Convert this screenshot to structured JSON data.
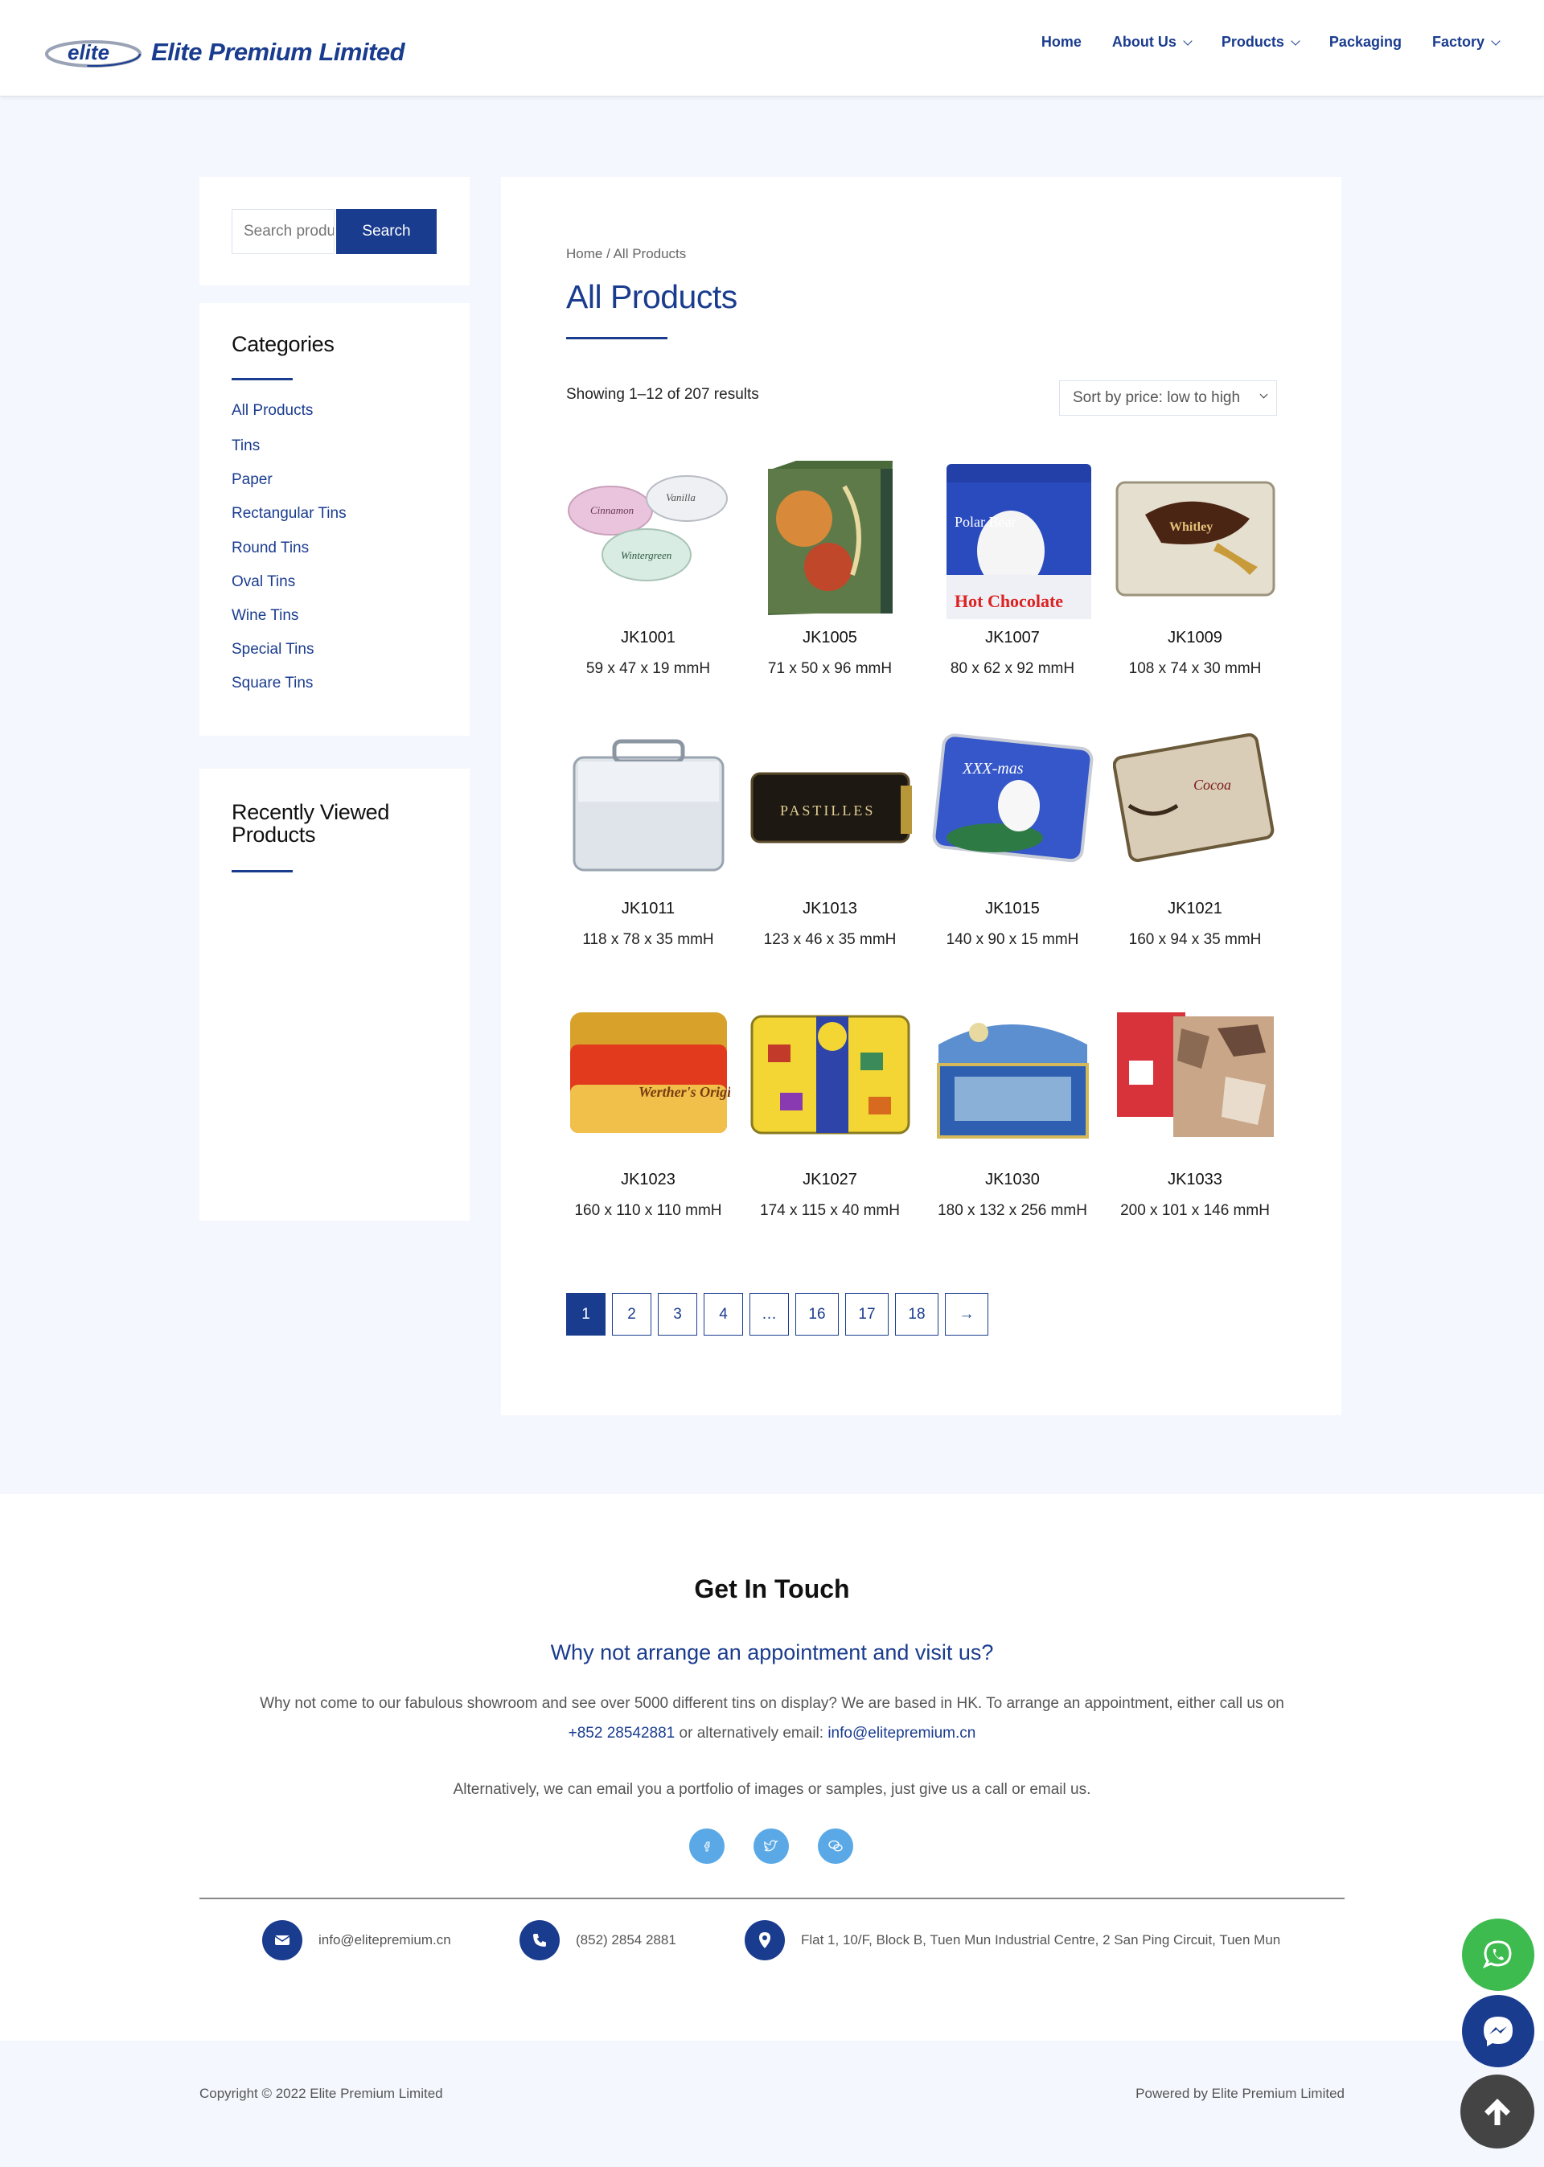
{
  "brand": {
    "logo_mark": "elite",
    "name": "Elite Premium Limited",
    "color": "#1a3c8f"
  },
  "nav": {
    "items": [
      {
        "label": "Home",
        "has_dropdown": false
      },
      {
        "label": "About Us",
        "has_dropdown": true
      },
      {
        "label": "Products",
        "has_dropdown": true
      },
      {
        "label": "Packaging",
        "has_dropdown": false
      },
      {
        "label": "Factory",
        "has_dropdown": true
      }
    ]
  },
  "sidebar": {
    "search": {
      "placeholder": "Search products…",
      "button_label": "Search"
    },
    "categories_title": "Categories",
    "categories": [
      "All Products",
      "Tins",
      "Paper",
      "Rectangular Tins",
      "Round Tins",
      "Oval Tins",
      "Wine Tins",
      "Special Tins",
      "Square Tins"
    ],
    "recent_title": "Recently Viewed Products"
  },
  "main": {
    "breadcrumb": "Home / All Products",
    "title": "All Products",
    "result_count": "Showing 1–12 of 207 results",
    "sort_selected": "Sort by price: low to high",
    "products": [
      {
        "sku": "JK1001",
        "dims": "59 x 47 x 19 mmH"
      },
      {
        "sku": "JK1005",
        "dims": "71 x 50 x 96 mmH"
      },
      {
        "sku": "JK1007",
        "dims": "80 x 62 x 92 mmH"
      },
      {
        "sku": "JK1009",
        "dims": "108 x 74 x 30 mmH"
      },
      {
        "sku": "JK1011",
        "dims": "118 x 78 x 35 mmH"
      },
      {
        "sku": "JK1013",
        "dims": "123 x 46 x 35 mmH"
      },
      {
        "sku": "JK1015",
        "dims": "140 x 90 x 15 mmH"
      },
      {
        "sku": "JK1021",
        "dims": "160 x 94 x 35 mmH"
      },
      {
        "sku": "JK1023",
        "dims": "160 x 110 x 110 mmH"
      },
      {
        "sku": "JK1027",
        "dims": "174 x 115 x 40 mmH"
      },
      {
        "sku": "JK1030",
        "dims": "180 x 132 x 256 mmH"
      },
      {
        "sku": "JK1033",
        "dims": "200 x 101 x 146 mmH"
      }
    ],
    "image_text": {
      "polar_bear": "Polar Bear",
      "hot_chocolate": "Hot Chocolate",
      "pastilles": "PASTILLES",
      "xmas": "XXX-mas",
      "cocoa": "Cocoa",
      "werthers": "Werther's Original"
    },
    "pagination": {
      "current": "1",
      "pages": [
        "1",
        "2",
        "3",
        "4",
        "…",
        "16",
        "17",
        "18",
        "→"
      ]
    }
  },
  "footer": {
    "title": "Get In Touch",
    "subtitle": "Why not arrange an appointment and visit us?",
    "para_before_phone": "Why not come to our fabulous showroom and see over 5000 different tins on display? We are based in HK. To arrange an appointment, either call us on ",
    "phone_link": "+852 28542881",
    "para_mid": " or alternatively email: ",
    "email_link": "info@elitepremium.cn",
    "para2": "Alternatively, we can email you a portfolio of images or samples, just give us a call or email us.",
    "contacts": {
      "email": "info@elitepremium.cn",
      "phone": "(852) 2854 2881",
      "address": "Flat 1, 10/F, Block B, Tuen Mun Industrial Centre, 2 San Ping Circuit, Tuen Mun"
    },
    "copyright": "Copyright © 2022 Elite Premium Limited",
    "powered_by": "Powered by Elite Premium Limited"
  },
  "floating": {
    "whatsapp_color": "#3dbb4f",
    "messenger_color": "#1a3c8f",
    "top_color": "#444444"
  }
}
